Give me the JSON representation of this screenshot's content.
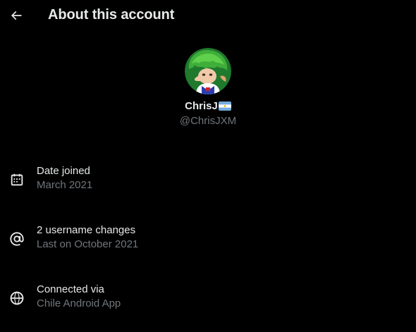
{
  "header": {
    "title": "About this account",
    "back_icon": "arrow-left-icon"
  },
  "profile": {
    "display_name": "ChrisJ",
    "flag_icon": "argentina-flag-icon",
    "handle": "@ChrisJXM",
    "avatar_icon": "avatar-image"
  },
  "info": [
    {
      "icon": "calendar-icon",
      "label": "Date joined",
      "value": "March 2021"
    },
    {
      "icon": "at-sign-icon",
      "label": "2 username changes",
      "value": "Last on October 2021"
    },
    {
      "icon": "globe-icon",
      "label": "Connected via",
      "value": "Chile Android App"
    }
  ],
  "colors": {
    "background": "#000000",
    "primary_text": "#e7e9ea",
    "secondary_text": "#71767b"
  }
}
